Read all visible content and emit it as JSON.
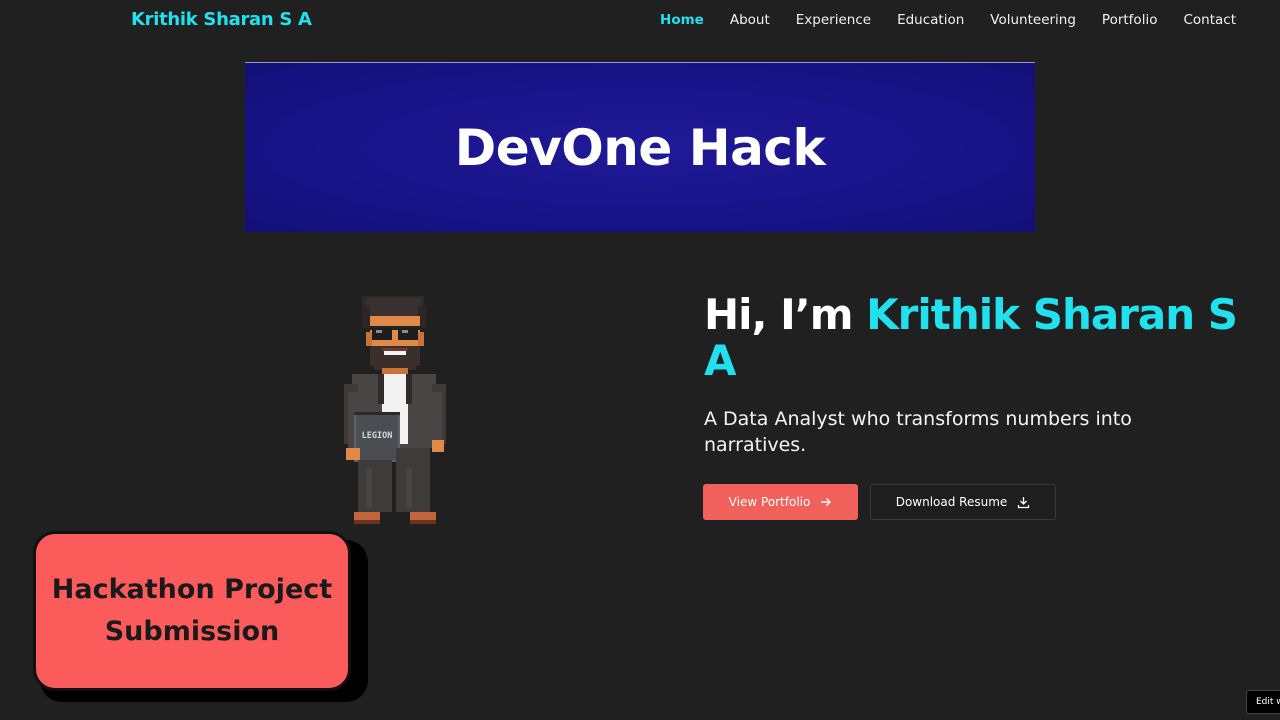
{
  "nav": {
    "brand": "Krithik Sharan S A",
    "links": [
      {
        "label": "Home",
        "active": true
      },
      {
        "label": "About"
      },
      {
        "label": "Experience"
      },
      {
        "label": "Education"
      },
      {
        "label": "Volunteering"
      },
      {
        "label": "Portfolio"
      },
      {
        "label": "Contact"
      }
    ]
  },
  "banner": {
    "title": "DevOne Hack"
  },
  "avatar": {
    "badge_text": "LEGION",
    "icon": "pixel-art-avatar"
  },
  "hero": {
    "greeting": "Hi, I’m",
    "name": "Krithik Sharan S A",
    "subtitle": "A Data Analyst who transforms numbers into narratives.",
    "primary_button": {
      "label": "View Portfolio",
      "icon": "arrow-right-icon"
    },
    "secondary_button": {
      "label": "Download Resume",
      "icon": "download-icon"
    }
  },
  "overlay_card": {
    "text": "Hackathon Project Submission"
  },
  "edit_badge": {
    "label": "Edit w"
  },
  "colors": {
    "background": "#202020",
    "accent": "#22e1ee",
    "primary_button": "#f2605b",
    "card": "#fb5b5b",
    "banner": "#19148a"
  }
}
